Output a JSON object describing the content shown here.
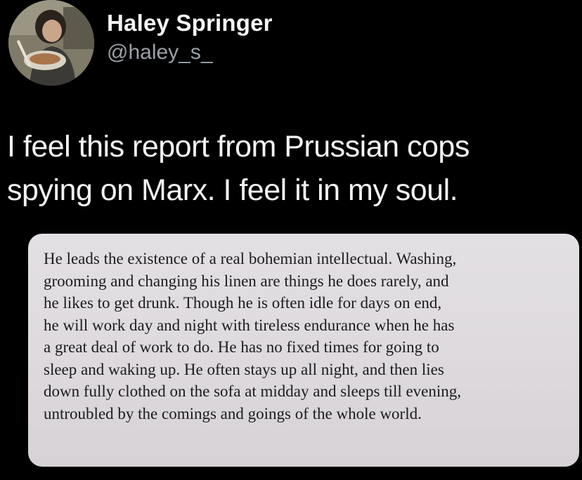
{
  "tweet": {
    "author_name": "Haley Springer",
    "author_handle": "@haley_s_",
    "text_lines": [
      "I feel this report from Prussian cops",
      "spying on Marx. I feel it in my soul."
    ]
  },
  "media": {
    "page_lines": [
      "He leads the existence of a real bohemian intellectual. Washing,",
      "grooming and changing his linen are things he does rarely, and",
      "he likes to get drunk. Though he is often idle for days on end,",
      "he will work day and night with tireless endurance when he has",
      "a great deal of work to do. He has no fixed times for going to",
      "sleep and waking up. He often stays up all night, and then lies",
      "down fully clothed on the sofa at midday and sleeps till evening,",
      "untroubled by the comings and goings of the whole world."
    ]
  },
  "icons": {
    "avatar": "profile-photo",
    "menu": "chevron-down-icon"
  },
  "colors": {
    "background": "#000000",
    "text_primary": "#f4f4f4",
    "text_secondary": "#9aa0a6",
    "media_background": "#dedade"
  }
}
